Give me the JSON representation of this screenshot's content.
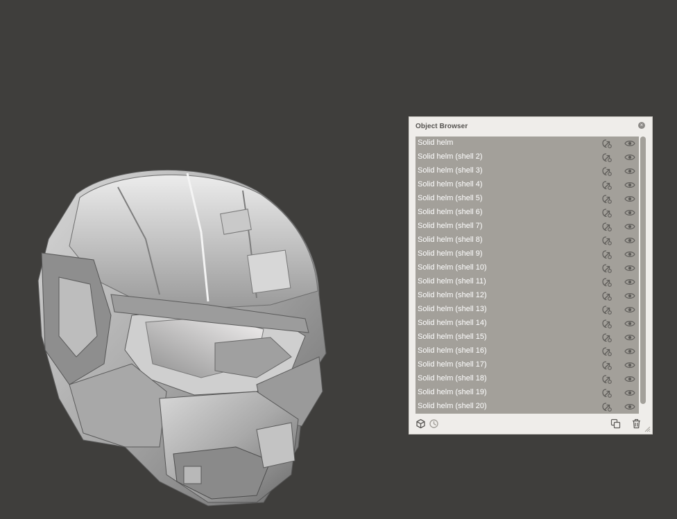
{
  "panel": {
    "title": "Object Browser",
    "close_icon": "close-icon",
    "items": [
      {
        "label": "Solid helm"
      },
      {
        "label": "Solid helm (shell 2)"
      },
      {
        "label": "Solid helm (shell 3)"
      },
      {
        "label": "Solid helm (shell 4)"
      },
      {
        "label": "Solid helm (shell 5)"
      },
      {
        "label": "Solid helm (shell 6)"
      },
      {
        "label": "Solid helm (shell 7)"
      },
      {
        "label": "Solid helm (shell 8)"
      },
      {
        "label": "Solid helm (shell 9)"
      },
      {
        "label": "Solid helm (shell 10)"
      },
      {
        "label": "Solid helm (shell 11)"
      },
      {
        "label": "Solid helm (shell 12)"
      },
      {
        "label": "Solid helm (shell 13)"
      },
      {
        "label": "Solid helm (shell 14)"
      },
      {
        "label": "Solid helm (shell 15)"
      },
      {
        "label": "Solid helm (shell 16)"
      },
      {
        "label": "Solid helm (shell 17)"
      },
      {
        "label": "Solid helm (shell 18)"
      },
      {
        "label": "Solid helm (shell 19)"
      },
      {
        "label": "Solid helm (shell 20)"
      }
    ],
    "row_icons": [
      "link-icon",
      "eye-icon"
    ],
    "footer_icons": [
      "cube-icon",
      "clock-icon",
      "duplicate-icon",
      "trash-icon"
    ]
  },
  "colors": {
    "viewport_background": "#3f3e3c",
    "panel_background": "#efedea",
    "row_background": "#a3a09a",
    "row_text": "#ffffff"
  }
}
